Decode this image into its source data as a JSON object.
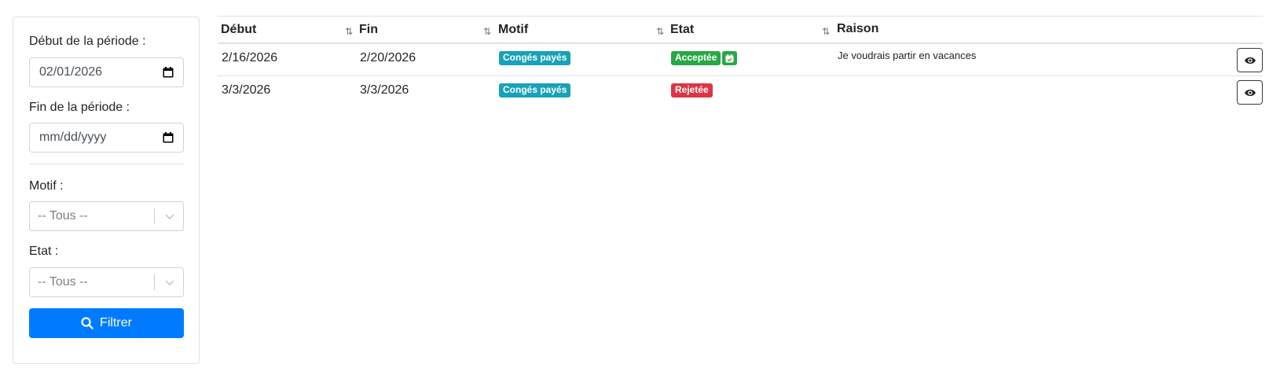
{
  "filters": {
    "period_start_label": "Début de la période :",
    "period_start_value": "02/01/2026",
    "period_end_label": "Fin de la période :",
    "period_end_placeholder": "mm/dd/yyyy",
    "motif_label": "Motif :",
    "motif_value": "-- Tous --",
    "etat_label": "Etat :",
    "etat_value": "-- Tous --",
    "filter_button": "Filtrer"
  },
  "table": {
    "headers": {
      "debut": "Début",
      "fin": "Fin",
      "motif": "Motif",
      "etat": "Etat",
      "raison": "Raison"
    },
    "rows": [
      {
        "debut": "2/16/2026",
        "fin": "2/20/2026",
        "motif": "Congés payés",
        "etat": "Acceptée",
        "raison": "Je voudrais partir en vacances"
      },
      {
        "debut": "3/3/2026",
        "fin": "3/3/2026",
        "motif": "Congés payés",
        "etat": "Rejetée",
        "raison": ""
      }
    ]
  },
  "icons": {
    "calendar": "calendar-icon",
    "chevron": "chevron-down-icon",
    "search": "search-icon",
    "sort": "sort-icon",
    "calendar_check": "calendar-check-icon",
    "eye": "eye-icon"
  },
  "colors": {
    "primary": "#007bff",
    "info": "#17a2b8",
    "success": "#28a745",
    "danger": "#dc3545"
  }
}
